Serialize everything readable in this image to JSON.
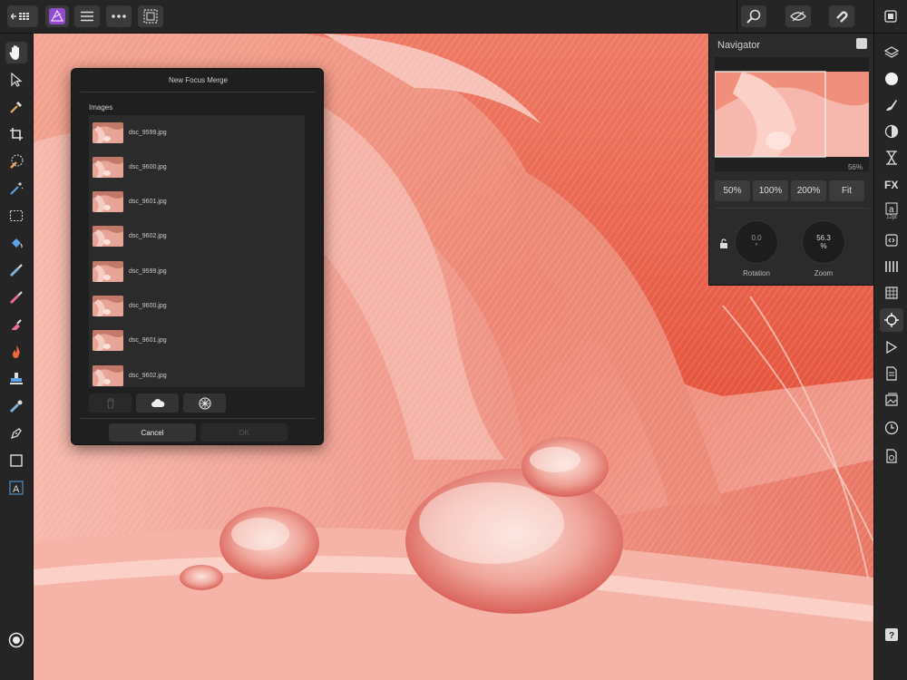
{
  "navigator": {
    "title": "Navigator",
    "zoom_readout": "56%",
    "zoom_buttons": [
      "50%",
      "100%",
      "200%",
      "Fit"
    ],
    "rotation": {
      "value": "0.0",
      "unit": "°",
      "label": "Rotation"
    },
    "zoom": {
      "value": "56.3",
      "unit": "%",
      "label": "Zoom"
    }
  },
  "dialog": {
    "title": "New Focus Merge",
    "images_label": "Images",
    "files": [
      "dsc_9599.jpg",
      "dsc_9600.jpg",
      "dsc_9601.jpg",
      "dsc_9602.jpg",
      "dsc_9599.jpg",
      "dsc_9600.jpg",
      "dsc_9601.jpg",
      "dsc_9602.jpg"
    ],
    "cancel_label": "Cancel",
    "ok_label": "OK"
  },
  "right_tools": {
    "text_size_label": "12pt"
  },
  "colors": {
    "accent_purple": "#8e4bd0",
    "panel_bg": "#252525",
    "canvas_base": "#f08a78"
  }
}
